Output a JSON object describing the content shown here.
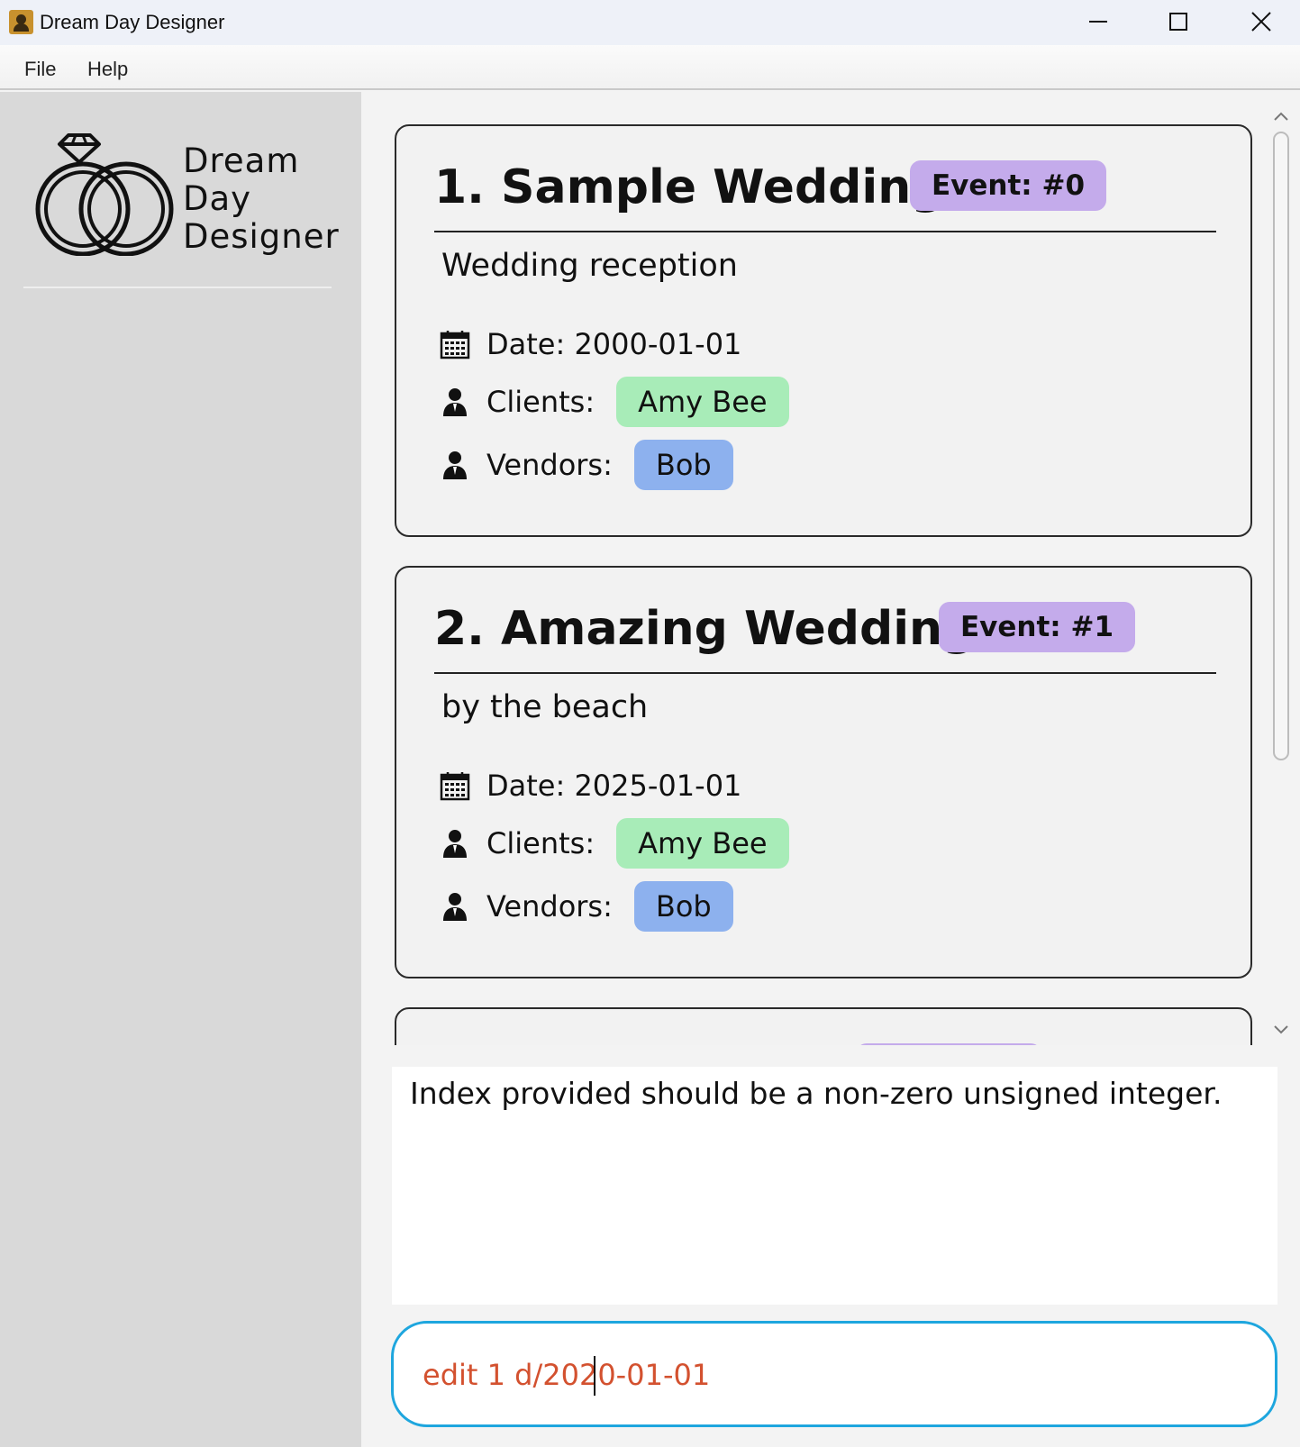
{
  "window": {
    "title": "Dream Day Designer"
  },
  "menu": {
    "file": "File",
    "help": "Help"
  },
  "sidebar": {
    "logo_line1": "Dream",
    "logo_line2": "Day",
    "logo_line3": "Designer"
  },
  "events": [
    {
      "title": "1. Sample Wedding",
      "badge": "Event: #0",
      "description": "Wedding reception",
      "date": "Date: 2000-01-01",
      "clients_label": "Clients:",
      "client": "Amy Bee",
      "vendors_label": "Vendors:",
      "vendor": "Bob"
    },
    {
      "title": "2. Amazing Wedding",
      "badge": "Event: #1",
      "description": "by the beach",
      "date": "Date: 2025-01-01",
      "clients_label": "Clients:",
      "client": "Amy Bee",
      "vendors_label": "Vendors:",
      "vendor": "Bob"
    }
  ],
  "result": {
    "message": "Index provided should be a non-zero unsigned integer."
  },
  "command": {
    "value": "edit 1 d/2020-01-01"
  },
  "colors": {
    "event_badge": "#c4abeb",
    "client_chip": "#a8ecb8",
    "vendor_chip": "#8db1ee",
    "command_text": "#d3512f",
    "command_border": "#1ea6de"
  }
}
